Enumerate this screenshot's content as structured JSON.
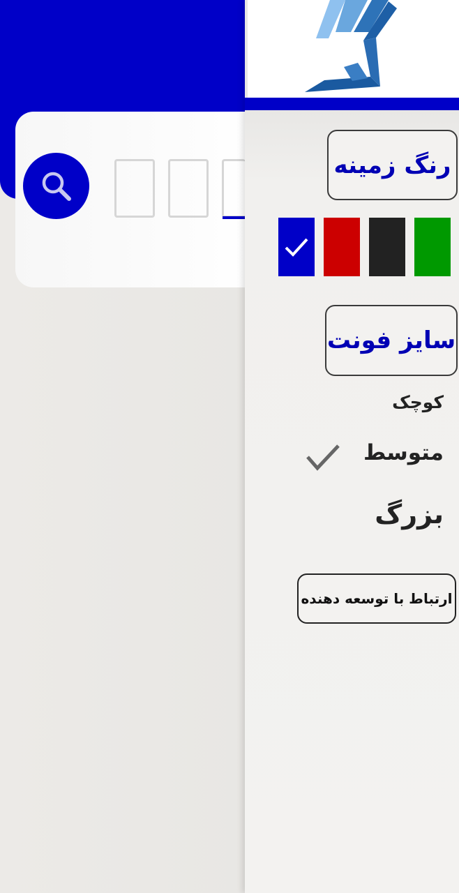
{
  "drawer": {
    "background_color_label": "رنگ زمینه",
    "font_size_label": "سایز فونت",
    "swatches": [
      {
        "name": "blue",
        "color": "#0000c8",
        "selected": true
      },
      {
        "name": "red",
        "color": "#cc0000",
        "selected": false
      },
      {
        "name": "black",
        "color": "#222222",
        "selected": false
      },
      {
        "name": "green",
        "color": "#009900",
        "selected": false
      }
    ],
    "font_sizes": {
      "small": "کوچک",
      "medium": "متوسط",
      "large": "بزرگ",
      "selected": "medium"
    },
    "contact_label": "ارتباط با توسعه دهنده"
  },
  "theme": {
    "accent": "#0000c8"
  },
  "icons": {
    "search": "search-icon",
    "check": "check-icon",
    "logo": "app-logo"
  }
}
